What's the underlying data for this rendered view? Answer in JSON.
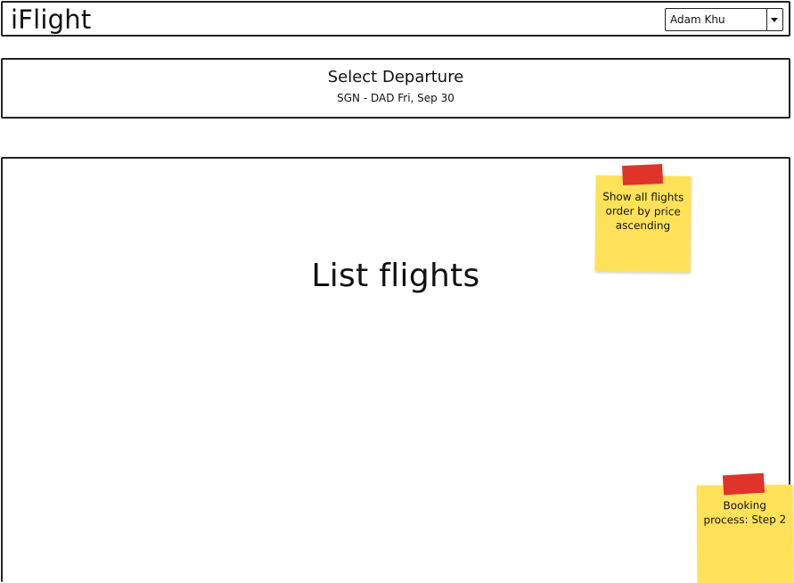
{
  "header": {
    "app_title": "iFlight",
    "user_select": {
      "value": "Adam Khu"
    }
  },
  "subheader": {
    "title": "Select Departure",
    "subtitle": "SGN - DAD Fri, Sep 30"
  },
  "main": {
    "placeholder": "List flights"
  },
  "notes": [
    {
      "text": "Show all flights order by price ascending"
    },
    {
      "text": "Booking process: Step 2"
    }
  ],
  "colors": {
    "sticky_note": "#ffe25a",
    "sticky_tape": "#e0332a",
    "border": "#222222"
  }
}
